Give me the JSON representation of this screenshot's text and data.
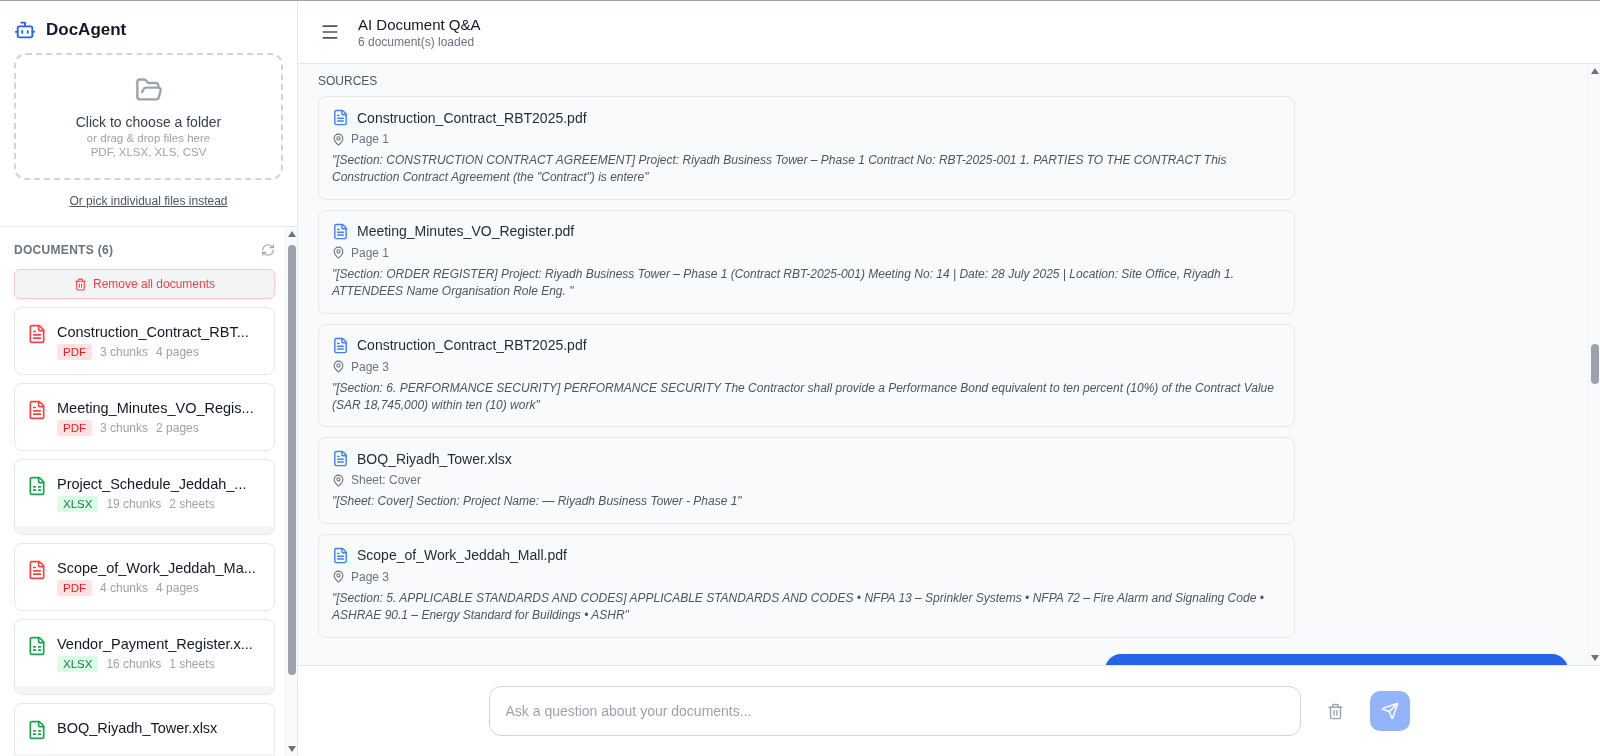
{
  "sidebar": {
    "brand": "DocAgent",
    "upload": {
      "title": "Click to choose a folder",
      "hint": "or drag & drop files here",
      "formats": "PDF, XLSX, XLS, CSV",
      "link": "Or pick individual files instead"
    },
    "documents_heading": "DOCUMENTS (6)",
    "remove_all": "Remove all documents",
    "documents": [
      {
        "name": "Construction_Contract_RBT...",
        "kind": "pdf",
        "type": "PDF",
        "chunks": "3 chunks",
        "size": "4 pages"
      },
      {
        "name": "Meeting_Minutes_VO_Regis...",
        "kind": "pdf",
        "type": "PDF",
        "chunks": "3 chunks",
        "size": "2 pages"
      },
      {
        "name": "Project_Schedule_Jeddah_...",
        "kind": "xlsx",
        "type": "XLSX",
        "chunks": "19 chunks",
        "size": "2 sheets"
      },
      {
        "name": "Scope_of_Work_Jeddah_Ma...",
        "kind": "pdf",
        "type": "PDF",
        "chunks": "4 chunks",
        "size": "4 pages"
      },
      {
        "name": "Vendor_Payment_Register.x...",
        "kind": "xlsx",
        "type": "XLSX",
        "chunks": "16 chunks",
        "size": "1 sheets"
      },
      {
        "name": "BOQ_Riyadh_Tower.xlsx",
        "kind": "xlsx"
      }
    ]
  },
  "header": {
    "title": "AI Document Q&A",
    "subtitle": "6 document(s) loaded"
  },
  "sources": {
    "heading": "SOURCES",
    "items": [
      {
        "file": "Construction_Contract_RBT2025.pdf",
        "location": "Page 1",
        "excerpt": "\"[Section: CONSTRUCTION CONTRACT AGREEMENT] Project: Riyadh Business Tower – Phase 1 Contract No: RBT-2025-001 1. PARTIES TO THE CONTRACT This Construction Contract Agreement (the \"Contract\") is entere\""
      },
      {
        "file": "Meeting_Minutes_VO_Register.pdf",
        "location": "Page 1",
        "excerpt": "\"[Section: ORDER REGISTER] Project: Riyadh Business Tower – Phase 1 (Contract RBT-2025-001) Meeting No: 14 | Date: 28 July 2025 | Location: Site Office, Riyadh 1. ATTENDEES Name Organisation Role Eng. \""
      },
      {
        "file": "Construction_Contract_RBT2025.pdf",
        "location": "Page 3",
        "excerpt": "\"[Section: 6. PERFORMANCE SECURITY] PERFORMANCE SECURITY The Contractor shall provide a Performance Bond equivalent to ten percent (10%) of the Contract Value (SAR 18,745,000) within ten (10) work\""
      },
      {
        "file": "BOQ_Riyadh_Tower.xlsx",
        "location": "Sheet: Cover",
        "excerpt": "\"[Sheet: Cover] Section: Project Name: — Riyadh Business Tower - Phase 1\""
      },
      {
        "file": "Scope_of_Work_Jeddah_Mall.pdf",
        "location": "Page 3",
        "excerpt": "\"[Section: 5. APPLICABLE STANDARDS AND CODES] APPLICABLE STANDARDS AND CODES • NFPA 13 – Sprinkler Systems • NFPA 72 – Fire Alarm and Signaling Code • ASHRAE 90.1 – Energy Standard for Buildings • ASHR\""
      }
    ]
  },
  "composer": {
    "placeholder": "Ask a question about your documents...",
    "send_disabled": true
  }
}
